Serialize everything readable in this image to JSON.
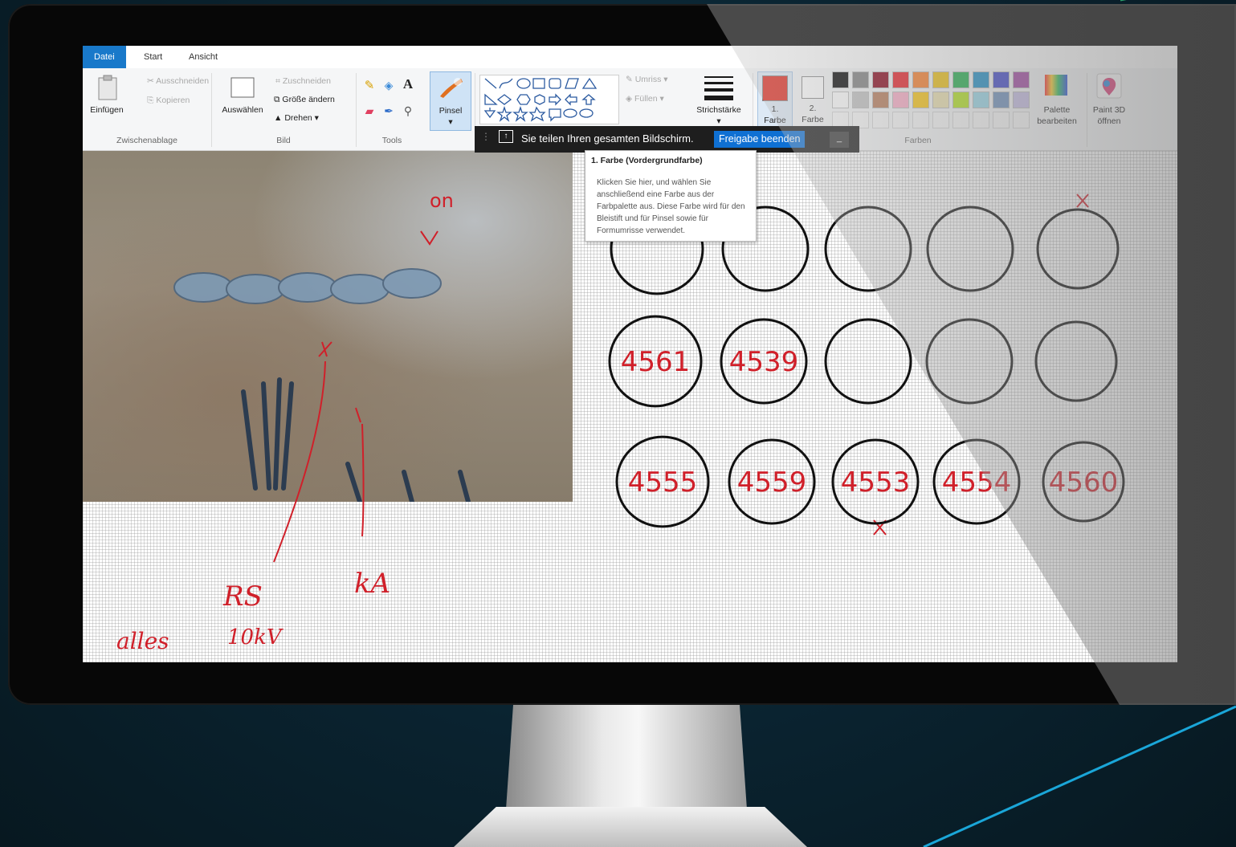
{
  "tabs": [
    {
      "label": "Datei",
      "active": true
    },
    {
      "label": "Start",
      "active": false
    },
    {
      "label": "Ansicht",
      "active": false
    }
  ],
  "clipboard": {
    "paste_label": "Einfügen",
    "cut_label": "Ausschneiden",
    "copy_label": "Kopieren",
    "group_label": "Zwischenablage"
  },
  "image_group": {
    "select_label": "Auswählen",
    "crop_label": "Zuschneiden",
    "resize_label": "Größe ändern",
    "rotate_label": "Drehen",
    "group_label": "Bild"
  },
  "tools_group": {
    "group_label": "Tools",
    "text_tool_label": "A"
  },
  "brush": {
    "label": "Pinsel"
  },
  "shapes": {
    "outline_label": "Umriss",
    "fill_label": "Füllen"
  },
  "stroke": {
    "label": "Strichstärke"
  },
  "colors": {
    "color1_number": "1.",
    "color1_word": "Farbe",
    "color2_number": "2.",
    "color2_word": "Farbe",
    "group_label": "Farben",
    "color1_value": "#e02a1f",
    "color2_value": "#ffffff",
    "palette_row1": [
      "#000000",
      "#7f7f7f",
      "#880015",
      "#ed1c24",
      "#ff7f27",
      "#f2c40f",
      "#22b14c",
      "#1e90c8",
      "#3f48cc",
      "#a349a4"
    ],
    "palette_row2": [
      "#ffffff",
      "#c3c3c3",
      "#b97a57",
      "#ffaec9",
      "#ffc90e",
      "#efe4b0",
      "#b5e61d",
      "#99d9ea",
      "#7092be",
      "#c8bfe7"
    ],
    "edit_palette_label_1": "Palette",
    "edit_palette_label_2": "bearbeiten",
    "paint3d_label_1": "Paint 3D",
    "paint3d_label_2": "öffnen"
  },
  "share_bar": {
    "message": "Sie teilen Ihren gesamten Bildschirm.",
    "stop_label": "Freigabe beenden",
    "minimize_label": "_"
  },
  "tooltip": {
    "title": "1. Farbe (Vordergrundfarbe)",
    "body": "Klicken Sie hier, und wählen Sie anschließend eine Farbe aus der Farbpalette aus. Diese Farbe wird für den Bleistift und für Pinsel sowie für Formumrisse verwendet."
  },
  "canvas": {
    "annotations": {
      "photo_mark": "on",
      "rs_label": "RS",
      "kv_label": "10kV",
      "ka_label": "kA",
      "alles_label": "alles"
    },
    "circle_labels": {
      "row2": [
        "4561",
        "4539",
        "",
        "",
        ""
      ],
      "row3": [
        "4555",
        "4559",
        "4553",
        "4554",
        "4560"
      ]
    }
  }
}
